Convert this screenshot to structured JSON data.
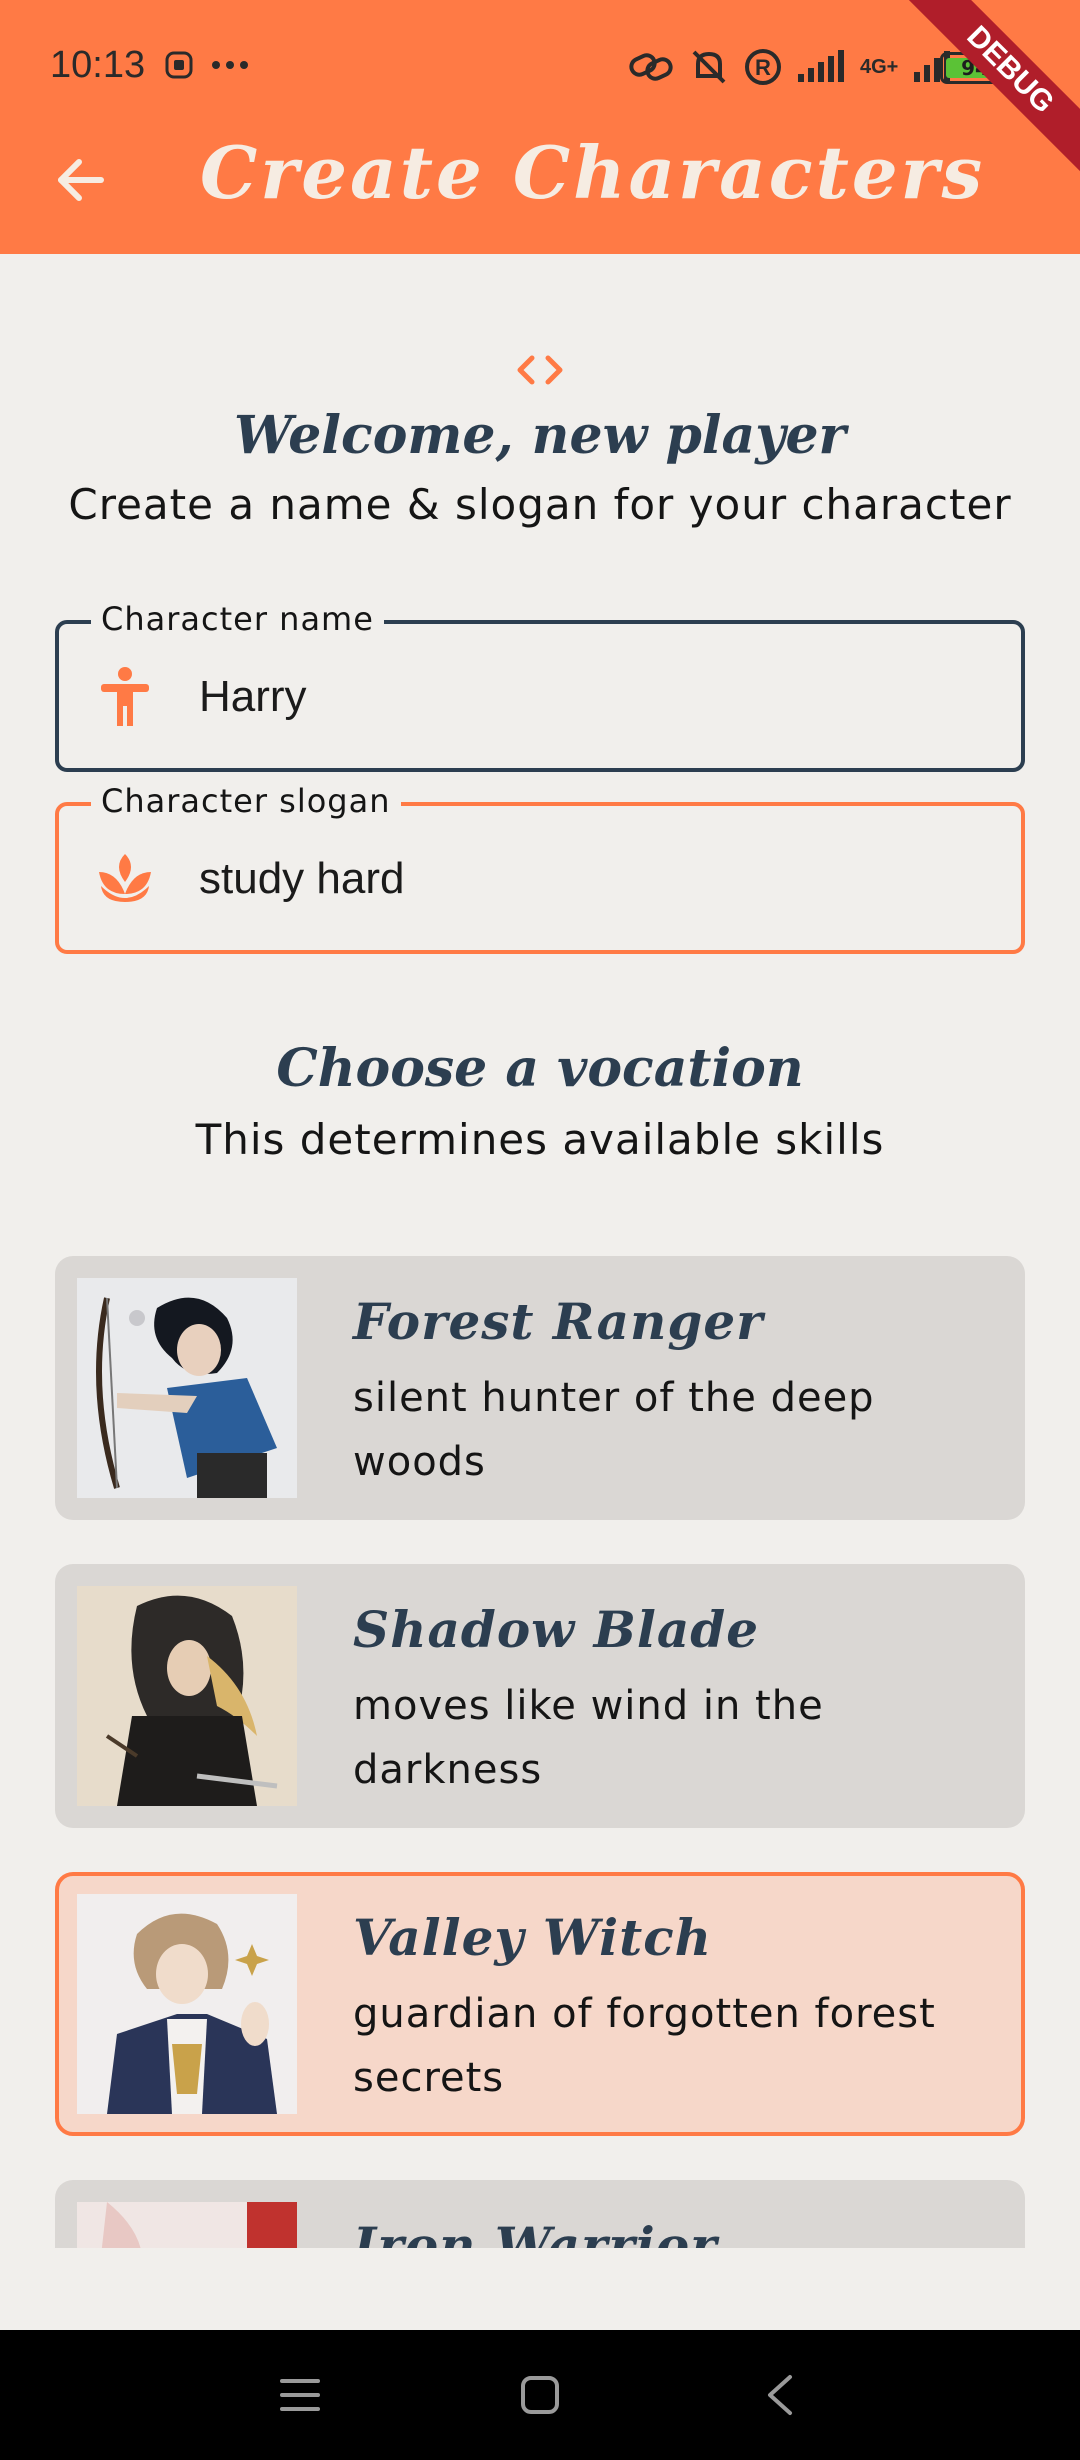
{
  "status_bar": {
    "time": "10:13",
    "battery": "94",
    "network": "4G+",
    "debug_banner": "DEBUG"
  },
  "header": {
    "title": "Create Characters",
    "back_icon": "arrow-left-icon"
  },
  "intro": {
    "icon": "code-brackets-icon",
    "title": "Welcome, new player",
    "subtitle": "Create a name & slogan for your character"
  },
  "form": {
    "name": {
      "label": "Character name",
      "value": "Harry",
      "icon": "accessibility-person-icon"
    },
    "slogan": {
      "label": "Character slogan",
      "value": "study hard",
      "icon": "spa-lotus-icon"
    }
  },
  "vocation": {
    "title": "Choose a vocation",
    "subtitle": "This determines available skills",
    "items": [
      {
        "name": "Forest Ranger",
        "desc": "silent hunter of the deep woods",
        "image": "archer-portrait",
        "selected": false
      },
      {
        "name": "Shadow Blade",
        "desc": "moves like wind in the darkness",
        "image": "hooded-rogue-portrait",
        "selected": false
      },
      {
        "name": "Valley Witch",
        "desc": "guardian of forgotten forest secrets",
        "image": "mage-portrait",
        "selected": true
      },
      {
        "name": "Iron Warrior",
        "desc": "",
        "image": "warrior-portrait",
        "selected": false
      }
    ]
  },
  "colors": {
    "accent": "#ff7a45",
    "primary_text": "#2c3e50",
    "background": "#f1efec",
    "card": "#dad7d4",
    "card_selected": "#f6d7c9"
  }
}
